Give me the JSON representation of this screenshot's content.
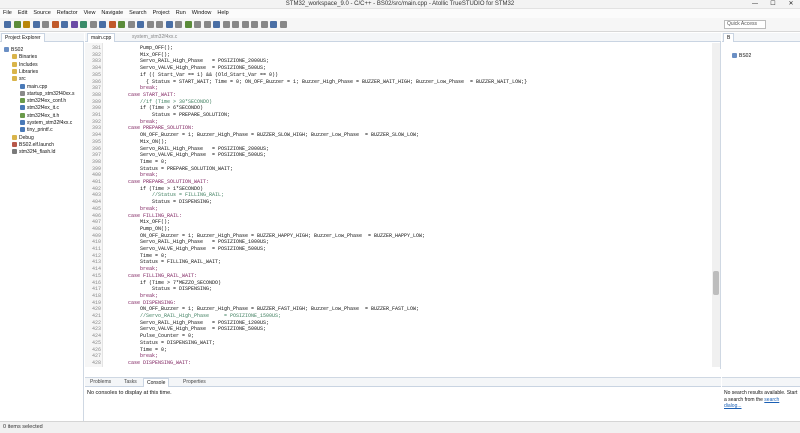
{
  "window": {
    "title": "STM32_workspace_9.0 - C/C++ - BS02/src/main.cpp - Atollic TrueSTUDIO for STM32",
    "minimize": "—",
    "maximize": "☐",
    "close": "✕"
  },
  "menu": [
    "File",
    "Edit",
    "Source",
    "Refactor",
    "View",
    "Navigate",
    "Search",
    "Project",
    "Run",
    "Window",
    "Help"
  ],
  "toolbar": {
    "quick_access_label": "Quick Access"
  },
  "explorer": {
    "tab_label": "Project Explorer",
    "items": [
      {
        "label": "BS02",
        "icon": "project-icon"
      },
      {
        "label": "Binaries",
        "icon": "folder-icon"
      },
      {
        "label": "Includes",
        "icon": "folder-icon"
      },
      {
        "label": "Libraries",
        "icon": "folder-icon"
      },
      {
        "label": "src",
        "icon": "folder-icon"
      },
      {
        "label": "main.cpp",
        "icon": "cpp-file-icon"
      },
      {
        "label": "startup_stm32f40xx.s",
        "icon": "asm-file-icon"
      },
      {
        "label": "stm32f4xx_conf.h",
        "icon": "header-file-icon"
      },
      {
        "label": "stm32f4xx_it.c",
        "icon": "c-file-icon"
      },
      {
        "label": "stm32f4xx_it.h",
        "icon": "header-file-icon"
      },
      {
        "label": "system_stm32f4xx.c",
        "icon": "c-file-icon"
      },
      {
        "label": "tiny_printf.c",
        "icon": "c-file-icon"
      },
      {
        "label": "Debug",
        "icon": "folder-icon"
      },
      {
        "label": "BS02.elf.launch",
        "icon": "launch-file-icon"
      },
      {
        "label": "stm32f4_flash.ld",
        "icon": "ld-file-icon"
      }
    ]
  },
  "editor": {
    "tabs": [
      "main.cpp",
      "system_stm32f4xx.c"
    ],
    "line_numbers": [
      "381",
      "382",
      "383",
      "384",
      "385",
      "386",
      "387",
      "388",
      "389",
      "390",
      "391",
      "392",
      "393",
      "394",
      "395",
      "396",
      "397",
      "398",
      "399",
      "400",
      "401",
      "402",
      "403",
      "404",
      "405",
      "406",
      "407",
      "408",
      "409",
      "410",
      "411",
      "412",
      "413",
      "414",
      "415",
      "416",
      "417",
      "418",
      "419",
      "420",
      "421",
      "422",
      "423",
      "424",
      "425",
      "426",
      "427",
      "428"
    ],
    "lines": [
      {
        "text": "            Pump_OFF();",
        "style": "code"
      },
      {
        "text": "            Mix_OFF();",
        "style": "code"
      },
      {
        "text": "            Servo_RAIL_High_Phase   = POSIZIONE_2000US;",
        "style": "code"
      },
      {
        "text": "            Servo_VALVE_High_Phase  = POSIZIONE_500US;",
        "style": "code"
      },
      {
        "text": "            if (( Start_Var == 1) && (Old_Start_Var == 0))",
        "style": "code"
      },
      {
        "text": "              { Status = START_WAIT; Time = 0; ON_OFF_Buzzer = 1; Buzzer_High_Phase = BUZZER_WAIT_HIGH; Buzzer_Low_Phase  = BUZZER_WAIT_LOW;}",
        "style": "code"
      },
      {
        "text": "            break;",
        "style": "kw"
      },
      {
        "text": "        case START_WAIT:",
        "style": "kw"
      },
      {
        "text": "            //if (Time > 30*SECONDO)",
        "style": "cm"
      },
      {
        "text": "            if (Time > 6*SECONDO)",
        "style": "code"
      },
      {
        "text": "                Status = PREPARE_SOLUTION;",
        "style": "code"
      },
      {
        "text": "            break;",
        "style": "kw"
      },
      {
        "text": "        case PREPARE_SOLUTION:",
        "style": "kw"
      },
      {
        "text": "            ON_OFF_Buzzer = 1; Buzzer_High_Phase = BUZZER_SLOW_HIGH; Buzzer_Low_Phase  = BUZZER_SLOW_LOW;",
        "style": "code"
      },
      {
        "text": "            Mix_ON();",
        "style": "code"
      },
      {
        "text": "            Servo_RAIL_High_Phase   = POSIZIONE_2000US;",
        "style": "code"
      },
      {
        "text": "            Servo_VALVE_High_Phase  = POSIZIONE_500US;",
        "style": "code"
      },
      {
        "text": "            Time = 0;",
        "style": "code"
      },
      {
        "text": "            Status = PREPARE_SOLUTION_WAIT;",
        "style": "code"
      },
      {
        "text": "            break;",
        "style": "kw"
      },
      {
        "text": "        case PREPARE_SOLUTION_WAIT:",
        "style": "kw"
      },
      {
        "text": "            if (Time > 1*SECONDO)",
        "style": "code"
      },
      {
        "text": "                //Status = FILLING_RAIL;",
        "style": "cm"
      },
      {
        "text": "                Status = DISPENSING;",
        "style": "code"
      },
      {
        "text": "            break;",
        "style": "kw"
      },
      {
        "text": "        case FILLING_RAIL:",
        "style": "kw"
      },
      {
        "text": "            Mix_OFF();",
        "style": "code"
      },
      {
        "text": "            Pump_ON();",
        "style": "code"
      },
      {
        "text": "            ON_OFF_Buzzer = 1; Buzzer_High_Phase = BUZZER_HAPPY_HIGH; Buzzer_Low_Phase  = BUZZER_HAPPY_LOW;",
        "style": "code"
      },
      {
        "text": "            Servo_RAIL_High_Phase   = POSIZIONE_1000US;",
        "style": "code"
      },
      {
        "text": "            Servo_VALVE_High_Phase  = POSIZIONE_500US;",
        "style": "code"
      },
      {
        "text": "            Time = 0;",
        "style": "code"
      },
      {
        "text": "            Status = FILLING_RAIL_WAIT;",
        "style": "code"
      },
      {
        "text": "            break;",
        "style": "kw"
      },
      {
        "text": "        case FILLING_RAIL_WAIT:",
        "style": "kw"
      },
      {
        "text": "            if (Time > 7*MEZZO_SECONDO)",
        "style": "code"
      },
      {
        "text": "                Status = DISPENSING;",
        "style": "code"
      },
      {
        "text": "            break;",
        "style": "kw"
      },
      {
        "text": "        case DISPENSING:",
        "style": "kw"
      },
      {
        "text": "            ON_OFF_Buzzer = 1; Buzzer_High_Phase = BUZZER_FAST_HIGH; Buzzer_Low_Phase  = BUZZER_FAST_LOW;",
        "style": "code"
      },
      {
        "text": "            //Servo_RAIL_High_Phase     = POSIZIONE_1500US;",
        "style": "cm"
      },
      {
        "text": "            Servo_RAIL_High_Phase   = POSIZIONE_1200US;",
        "style": "code"
      },
      {
        "text": "            Servo_VALVE_High_Phase  = POSIZIONE_500US;",
        "style": "code"
      },
      {
        "text": "            Pulse_Counter = 0;",
        "style": "code"
      },
      {
        "text": "            Status = DISPENSING_WAIT;",
        "style": "code"
      },
      {
        "text": "            Time = 0;",
        "style": "code"
      },
      {
        "text": "            break;",
        "style": "kw"
      },
      {
        "text": "        case DISPENSING_WAIT:",
        "style": "kw"
      }
    ]
  },
  "outline": {
    "tab_label": "B",
    "item_label": "BS02"
  },
  "console": {
    "tabs": [
      "Problems",
      "Tasks",
      "Console",
      "Properties"
    ],
    "message": "No consoles to display at this time."
  },
  "search": {
    "message_part1": "No search results available. Start a search from the",
    "link_text": "search dialog..."
  },
  "status": {
    "text": "0 items selected"
  },
  "colors": {
    "keyword": "#7a1a5a",
    "comment": "#3f7f5f",
    "accent": "#1a5fb4"
  }
}
